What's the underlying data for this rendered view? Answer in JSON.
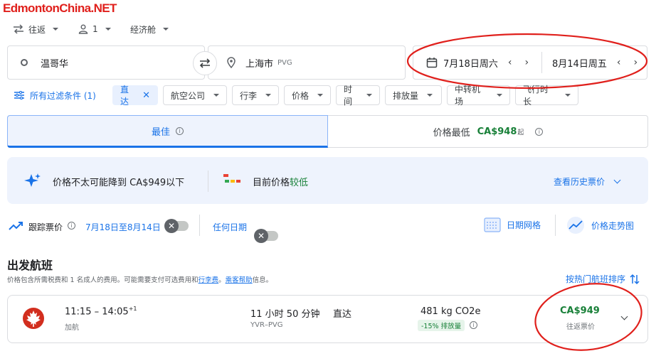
{
  "watermark": "EdmontonChina.NET",
  "topbar": {
    "trip_type": "往返",
    "passengers": "1",
    "cabin": "经济舱"
  },
  "search": {
    "origin": "温哥华",
    "destination": "上海市",
    "destination_code": "PVG",
    "depart_date": "7月18日周六",
    "return_date": "8月14日周五"
  },
  "filters": {
    "all_filters": "所有过滤条件 (1)",
    "active_chip": "直达",
    "chips": [
      "航空公司",
      "行李",
      "价格",
      "时间",
      "排放量",
      "中转机场",
      "飞行时长"
    ]
  },
  "sort_tabs": {
    "best": "最佳",
    "cheapest": "价格最低",
    "cheapest_price": "CA$948",
    "cheapest_suffix": "起"
  },
  "insight": {
    "prediction": "价格不太可能降到 CA$949以下",
    "current_prefix": "目前价格",
    "current_level": "较低",
    "history_link": "查看历史票价"
  },
  "tracking": {
    "track_label": "跟踪票价",
    "date_range": "7月18日至8月14日",
    "any_dates": "任何日期",
    "date_grid": "日期网格",
    "price_graph": "价格走势图"
  },
  "departures": {
    "title": "出发航班",
    "note_prefix": "价格包含所需税费和 1 名成人的费用。可能需要支付可选费用和",
    "baggage_fees": "行李费",
    "note_sep": "。",
    "passenger_help": "乘客帮助",
    "note_suffix": "信息。",
    "sort_label": "按热门航班排序"
  },
  "flight": {
    "times": "11:15 – 14:05",
    "day_offset": "+1",
    "airline": "加航",
    "duration": "11 小时 50 分钟",
    "route": "YVR–PVG",
    "stops": "直达",
    "emissions": "481 kg CO2e",
    "emissions_badge": "-15% 排放量",
    "price": "CA$949",
    "price_type": "往返票价"
  },
  "colors": {
    "accent": "#1a73e8",
    "green": "#188038",
    "annotation": "#e0201c",
    "airline": "#d22e1e"
  }
}
